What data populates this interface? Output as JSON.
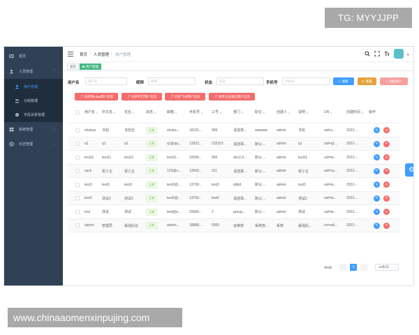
{
  "watermarks": {
    "top": "TG: MYYJJPP",
    "bottom": "www.chinaaomenxinpujing.com"
  },
  "colors": {
    "sidebar_bg": "#304156",
    "primary": "#409eff",
    "success": "#67c23a",
    "danger": "#f56c6c",
    "warning": "#e6a23c",
    "tag_active": "#42b983"
  },
  "sidebar": {
    "items": [
      {
        "label": "首页",
        "icon": "dashboard-icon"
      },
      {
        "label": "人员管理",
        "icon": "user-icon",
        "expanded": true
      },
      {
        "label": "用户管理",
        "icon": "user-sub-icon",
        "active": true
      },
      {
        "label": "分组管理",
        "icon": "group-icon"
      },
      {
        "label": "字段关系管理",
        "icon": "settings-icon"
      },
      {
        "label": "系统管理",
        "icon": "grid-icon"
      },
      {
        "label": "日志管理",
        "icon": "log-icon"
      }
    ]
  },
  "navbar": {
    "breadcrumb": [
      "首页",
      "人员管理",
      "用户管理"
    ],
    "sep": "/",
    "icons": [
      "search-icon",
      "fullscreen-icon",
      "font-size-icon"
    ],
    "avatar_caret": "▾"
  },
  "tags": {
    "home": "首页",
    "current": "用户管理"
  },
  "filters": {
    "username_label": "用户名",
    "username_placeholder": "用户名",
    "nickname_label": "昵称",
    "nickname_placeholder": "昵称",
    "status_label": "状态",
    "status_placeholder": "状态",
    "phone_label": "手机号",
    "phone_placeholder": "手机号",
    "search_btn": "搜索",
    "reset_btn": "重置",
    "add_btn": "添加用户"
  },
  "sync_buttons": [
    "同步明Ldap用户信息",
    "同步钉钉用户信息",
    "同步飞书用户信息",
    "同步企业微信用户信息"
  ],
  "table": {
    "headers": [
      "用户名",
      "中文名",
      "花名",
      "状态",
      "邮箱",
      "手机号",
      "工号",
      "部门",
      "职位",
      "创建人",
      "说明",
      "DN",
      "创建时间",
      "操作"
    ],
    "rows": [
      [
        "shubao",
        "书包",
        "书包社",
        "正常",
        "shuba...",
        "18101...",
        "999",
        "请选择...",
        "wwwww",
        "admin",
        "书包",
        "uid=s...",
        "2022-..."
      ],
      [
        "q1",
        "q1",
        "q1",
        "正常",
        "q1@qq...",
        "13322...",
        "232323",
        "请选择...",
        "默认:...",
        "admin",
        "q1",
        "uid=q1...",
        "2022-..."
      ],
      [
        "test11",
        "test11",
        "test11",
        "正常",
        "test11...",
        "15555...",
        "555",
        "dev2,d...",
        "默认:...",
        "admin",
        "test11",
        "uid=te...",
        "2022-..."
      ],
      [
        "zack",
        "祝小主",
        "祝小主",
        "正常",
        "123@s...",
        "13500...",
        "111",
        "请选择...",
        "默认:...",
        "admin",
        "祝小主",
        "uid=za...",
        "2022-..."
      ],
      [
        "test3",
        "test3",
        "test3",
        "正常",
        "test3@...",
        "13700...",
        "test3",
        "dddd",
        "默认:...",
        "admin",
        "test3",
        "uid=te...",
        "2022-..."
      ],
      [
        "test2",
        "测试2",
        "测试2",
        "正常",
        "test2@...",
        "13700...",
        "test2",
        "请选择...",
        "默认:...",
        "admin",
        "测试2",
        "uid=te...",
        "2022-..."
      ],
      [
        "test",
        "测试",
        "测试",
        "正常",
        "test@e...",
        "15666...",
        "2",
        "group,...",
        "默认:...",
        "admin",
        "测试",
        "uid=te...",
        "2022-..."
      ],
      [
        "admin",
        "管理员",
        "最强后台",
        "正常",
        "admin...",
        "18888...",
        "0000",
        "运维部",
        "系统管...",
        "系统",
        "最强后...",
        "cn=adi...",
        "2022-..."
      ]
    ]
  },
  "pagination": {
    "total": "共8条",
    "prev": "‹",
    "current": "1",
    "next": "›",
    "page_size": "10条/页"
  }
}
